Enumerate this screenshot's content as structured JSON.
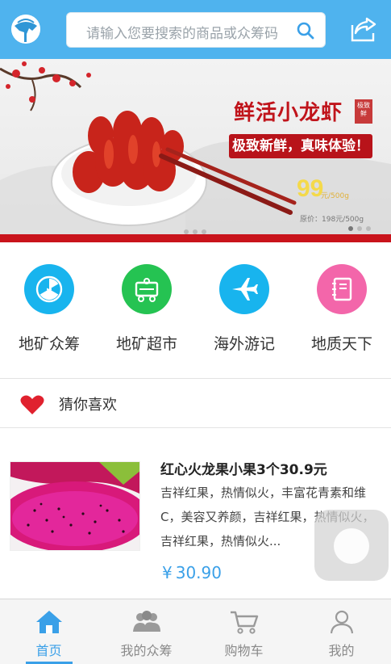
{
  "header": {
    "search_placeholder": "请输入您要搜索的商品或众筹码"
  },
  "banner": {
    "title": "鲜活小龙虾",
    "seal_text": "极致鲜",
    "subtitle": "极致新鲜，真味体验！",
    "price": "99",
    "price_unit": "元/500g",
    "original_price": "原价：198元/500g"
  },
  "categories": [
    {
      "label": "地矿众筹",
      "icon": "radiation-icon",
      "color": "#18b4ee"
    },
    {
      "label": "地矿超市",
      "icon": "shopping-cart-icon",
      "color": "#25c352"
    },
    {
      "label": "海外游记",
      "icon": "airplane-icon",
      "color": "#18b4ee"
    },
    {
      "label": "地质天下",
      "icon": "notebook-icon",
      "color": "#f366aa"
    }
  ],
  "guess": {
    "title": "猜你喜欢"
  },
  "product": {
    "title": "红心火龙果小果3个30.9元",
    "description": "吉祥红果，热情似火，丰富花青素和维C，美容又养颜，吉祥红果，热情似火，吉祥红果，热情似火...",
    "price_symbol": "¥",
    "price": "30.90"
  },
  "nav": [
    {
      "label": "首页",
      "icon": "home-icon",
      "active": true
    },
    {
      "label": "我的众筹",
      "icon": "group-icon",
      "active": false
    },
    {
      "label": "购物车",
      "icon": "cart-icon",
      "active": false
    },
    {
      "label": "我的",
      "icon": "user-icon",
      "active": false
    }
  ],
  "colors": {
    "header_bg": "#4fb3ee",
    "accent": "#3aa0e8",
    "banner_red": "#c0141b",
    "heart": "#e0212e"
  }
}
